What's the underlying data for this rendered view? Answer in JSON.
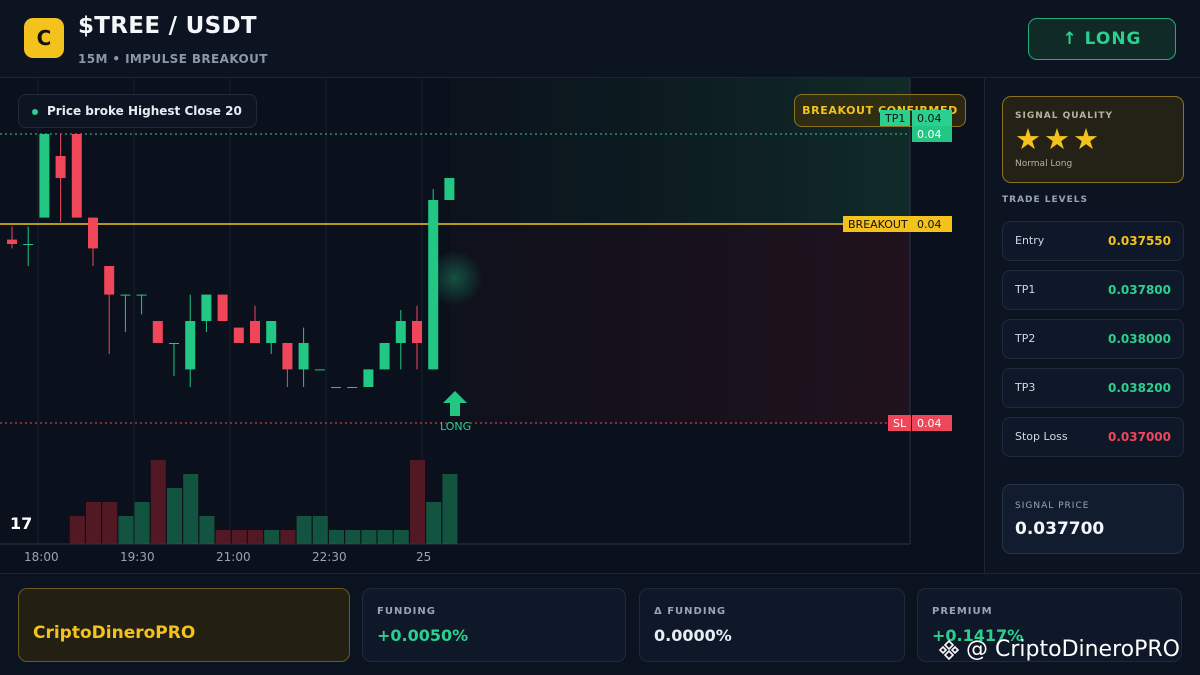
{
  "header": {
    "logo_letter": "C",
    "pair": "$TREE / USDT",
    "subtitle": "15M • IMPULSE BREAKOUT",
    "signal_button": "↑ LONG"
  },
  "chart": {
    "info_pill": "Price broke Highest Close 20",
    "status_badge": "BREAKOUT CONFIRMED",
    "levels": {
      "tp1": {
        "label": "TP1",
        "value": "0.04"
      },
      "breakout": {
        "label": "BREAKOUT",
        "value": "0.04"
      },
      "sl": {
        "label": "SL",
        "value": "0.04"
      },
      "current_price": "0.04"
    },
    "signal_marker_label": "LONG",
    "tv_logo": "17",
    "time_labels": [
      "18:00",
      "19:30",
      "21:00",
      "22:30",
      "25"
    ],
    "colors": {
      "up": "#22c784",
      "down": "#f0465a",
      "breakout": "#f3c21c"
    }
  },
  "chart_data": {
    "type": "candlestick",
    "x_tick_labels": [
      "18:00",
      "19:30",
      "21:00",
      "22:30",
      "25"
    ],
    "price_levels": {
      "tp1": 0.0378,
      "breakout": 0.03755,
      "stop_loss": 0.037
    },
    "candles": [
      {
        "open": 0.03752,
        "high": 0.03758,
        "low": 0.03748,
        "close": 0.0375
      },
      {
        "open": 0.0375,
        "high": 0.03758,
        "low": 0.0374,
        "close": 0.0375
      },
      {
        "open": 0.03762,
        "high": 0.038,
        "low": 0.03762,
        "close": 0.038
      },
      {
        "open": 0.0379,
        "high": 0.038,
        "low": 0.0376,
        "close": 0.0378
      },
      {
        "open": 0.038,
        "high": 0.038,
        "low": 0.03762,
        "close": 0.03762
      },
      {
        "open": 0.03762,
        "high": 0.03762,
        "low": 0.0374,
        "close": 0.03748
      },
      {
        "open": 0.0374,
        "high": 0.0374,
        "low": 0.037,
        "close": 0.03727
      },
      {
        "open": 0.03727,
        "high": 0.03727,
        "low": 0.0371,
        "close": 0.03727
      },
      {
        "open": 0.03727,
        "high": 0.03727,
        "low": 0.03718,
        "close": 0.03727
      },
      {
        "open": 0.03715,
        "high": 0.03715,
        "low": 0.03705,
        "close": 0.03705
      },
      {
        "open": 0.03705,
        "high": 0.03705,
        "low": 0.0369,
        "close": 0.03705
      },
      {
        "open": 0.03693,
        "high": 0.03727,
        "low": 0.03685,
        "close": 0.03715
      },
      {
        "open": 0.03715,
        "high": 0.03727,
        "low": 0.0371,
        "close": 0.03727
      },
      {
        "open": 0.03727,
        "high": 0.03727,
        "low": 0.03715,
        "close": 0.03715
      },
      {
        "open": 0.03712,
        "high": 0.03712,
        "low": 0.03705,
        "close": 0.03705
      },
      {
        "open": 0.03715,
        "high": 0.03722,
        "low": 0.03705,
        "close": 0.03705
      },
      {
        "open": 0.03705,
        "high": 0.03715,
        "low": 0.037,
        "close": 0.03715
      },
      {
        "open": 0.03705,
        "high": 0.03705,
        "low": 0.03685,
        "close": 0.03693
      },
      {
        "open": 0.03693,
        "high": 0.03712,
        "low": 0.03685,
        "close": 0.03705
      },
      {
        "open": 0.03693,
        "high": 0.03693,
        "low": 0.03693,
        "close": 0.03693
      },
      {
        "open": 0.03685,
        "high": 0.03685,
        "low": 0.03685,
        "close": 0.03685
      },
      {
        "open": 0.03685,
        "high": 0.03685,
        "low": 0.03685,
        "close": 0.03685
      },
      {
        "open": 0.03685,
        "high": 0.03693,
        "low": 0.03685,
        "close": 0.03693
      },
      {
        "open": 0.03693,
        "high": 0.03705,
        "low": 0.03693,
        "close": 0.03705
      },
      {
        "open": 0.03705,
        "high": 0.0372,
        "low": 0.03693,
        "close": 0.03715
      },
      {
        "open": 0.03715,
        "high": 0.03722,
        "low": 0.03693,
        "close": 0.03705
      },
      {
        "open": 0.03693,
        "high": 0.03775,
        "low": 0.03693,
        "close": 0.0377
      },
      {
        "open": 0.0377,
        "high": 0.0378,
        "low": 0.0377,
        "close": 0.0378
      }
    ],
    "volume": [
      0,
      0,
      0,
      0,
      2,
      3,
      3,
      2,
      3,
      6,
      4,
      5,
      2,
      1,
      1,
      1,
      1,
      1,
      2,
      2,
      1,
      1,
      1,
      1,
      1,
      6,
      3,
      5
    ]
  },
  "panel": {
    "quality_label": "SIGNAL QUALITY",
    "stars": "★★★",
    "quality_type": "Normal Long",
    "trade_levels_label": "TRADE LEVELS",
    "levels": [
      {
        "name": "Entry",
        "value": "0.037550",
        "color": "#f3c21c"
      },
      {
        "name": "TP1",
        "value": "0.037800",
        "color": "#2bd08f"
      },
      {
        "name": "TP2",
        "value": "0.038000",
        "color": "#2bd08f"
      },
      {
        "name": "TP3",
        "value": "0.038200",
        "color": "#2bd08f"
      },
      {
        "name": "Stop Loss",
        "value": "0.037000",
        "color": "#f0465a"
      }
    ],
    "signal_price_label": "SIGNAL PRICE",
    "signal_price_value": "0.037700"
  },
  "footer": {
    "brand": "CriptoDineroPRO",
    "funding_label": "FUNDING",
    "funding_value": "+0.0050%",
    "delta_funding_label": "Δ FUNDING",
    "delta_funding_value": "0.0000%",
    "premium_label": "PREMIUM",
    "premium_value": "+0.1417%",
    "watermark": "@ CriptoDineroPRO"
  }
}
